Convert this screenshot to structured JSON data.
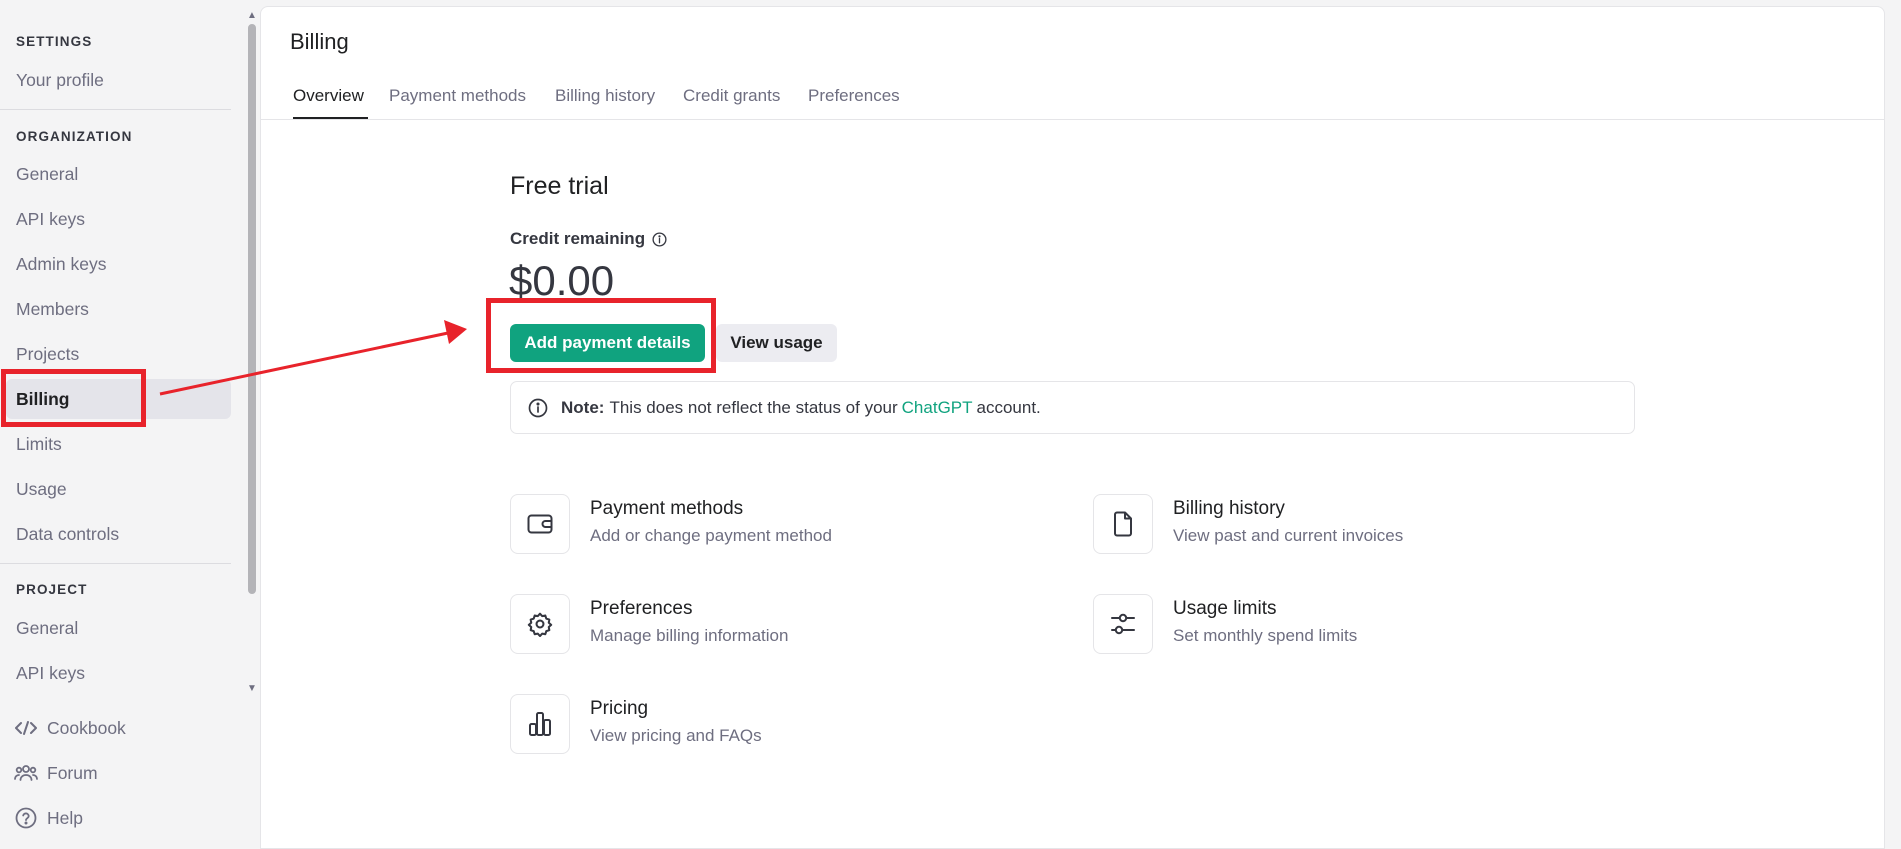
{
  "sidebar": {
    "settings_heading": "SETTINGS",
    "your_profile": "Your profile",
    "organization_heading": "ORGANIZATION",
    "org_items": [
      "General",
      "API keys",
      "Admin keys",
      "Members",
      "Projects",
      "Billing",
      "Limits",
      "Usage",
      "Data controls"
    ],
    "project_heading": "PROJECT",
    "project_items": [
      "General",
      "API keys"
    ],
    "bottom_links": [
      "Cookbook",
      "Forum",
      "Help"
    ],
    "active_item": "Billing"
  },
  "page": {
    "title": "Billing",
    "tabs": [
      "Overview",
      "Payment methods",
      "Billing history",
      "Credit grants",
      "Preferences"
    ],
    "active_tab": "Overview"
  },
  "overview": {
    "plan_title": "Free trial",
    "credit_label": "Credit remaining",
    "credit_amount": "$0.00",
    "add_payment_button": "Add payment details",
    "view_usage_button": "View usage",
    "note_label": "Note:",
    "note_text_before": "This does not reflect the status of your",
    "note_link": "ChatGPT",
    "note_text_after": "account."
  },
  "cards": [
    {
      "title": "Payment methods",
      "subtitle": "Add or change payment method",
      "icon": "wallet-icon"
    },
    {
      "title": "Billing history",
      "subtitle": "View past and current invoices",
      "icon": "document-icon"
    },
    {
      "title": "Preferences",
      "subtitle": "Manage billing information",
      "icon": "gear-icon"
    },
    {
      "title": "Usage limits",
      "subtitle": "Set monthly spend limits",
      "icon": "sliders-icon"
    },
    {
      "title": "Pricing",
      "subtitle": "View pricing and FAQs",
      "icon": "bar-chart-icon"
    }
  ],
  "colors": {
    "accent": "#10a37f",
    "annotation": "#e8232b"
  }
}
